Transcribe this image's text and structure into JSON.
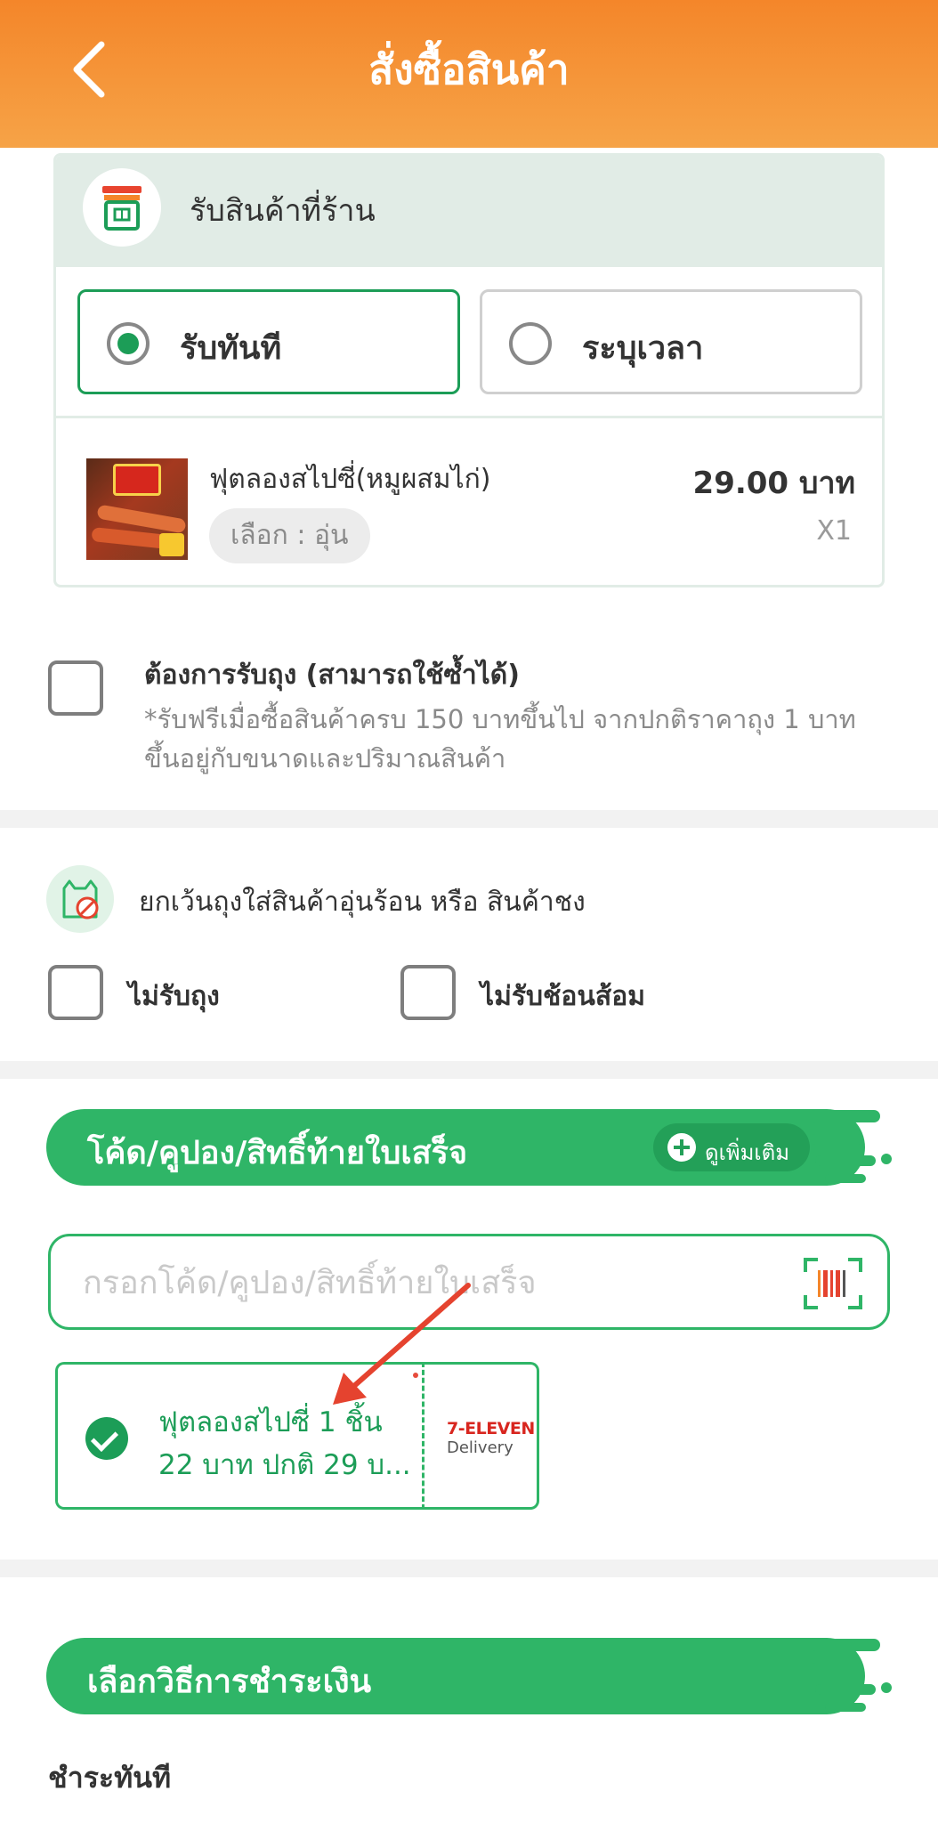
{
  "header": {
    "title": "สั่งซื้อสินค้า",
    "back_icon": "chevron-left-icon"
  },
  "pickup": {
    "title": "รับสินค้าที่ร้าน",
    "store_icon": "store-icon",
    "options": [
      {
        "label": "รับทันที",
        "selected": true
      },
      {
        "label": "ระบุเวลา",
        "selected": false
      }
    ]
  },
  "product": {
    "name": "ฟุตลองสไปซี่(หมูผสมไก่)",
    "option": "เลือก : อุ่น",
    "price": "29.00 บาท",
    "qty": "X1"
  },
  "bag": {
    "title": "ต้องการรับถุง (สามารถใช้ซ้ำได้)",
    "note": "*รับฟรีเมื่อซื้อสินค้าครบ 150 บาทขึ้นไป จากปกติราคาถุง 1 บาท ขึ้นอยู่กับขนาดและปริมาณสินค้า",
    "checked": false
  },
  "exceptions": {
    "text": "ยกเว้นถุงใส่สินค้าอุ่นร้อน หรือ สินค้าชง",
    "no_bag": "ไม่รับถุง",
    "no_cutlery": "ไม่รับช้อนส้อม"
  },
  "coupon_section": {
    "title": "โค้ด/คูปอง/สิทธิ์ท้ายใบเสร็จ",
    "more": "ดูเพิ่มเติม",
    "input_placeholder": "กรอกโค้ด/คูปอง/สิทธิ์ท้ายใบเสร็จ",
    "coupon": {
      "line1": "ฟุตลองสไปซี่ 1 ชิ้น",
      "line2": "22 บาท ปกติ 29 บ...",
      "brand": "7-ELEVEN",
      "brand_sub": "Delivery",
      "selected": true
    }
  },
  "payment": {
    "title": "เลือกวิธีการชำระเงิน",
    "pay_now": "ชำระทันที"
  },
  "colors": {
    "brand_orange": "#f4862a",
    "brand_green": "#2fb567",
    "selected_green": "#1c9d57",
    "annotation_red": "#e5432f"
  }
}
